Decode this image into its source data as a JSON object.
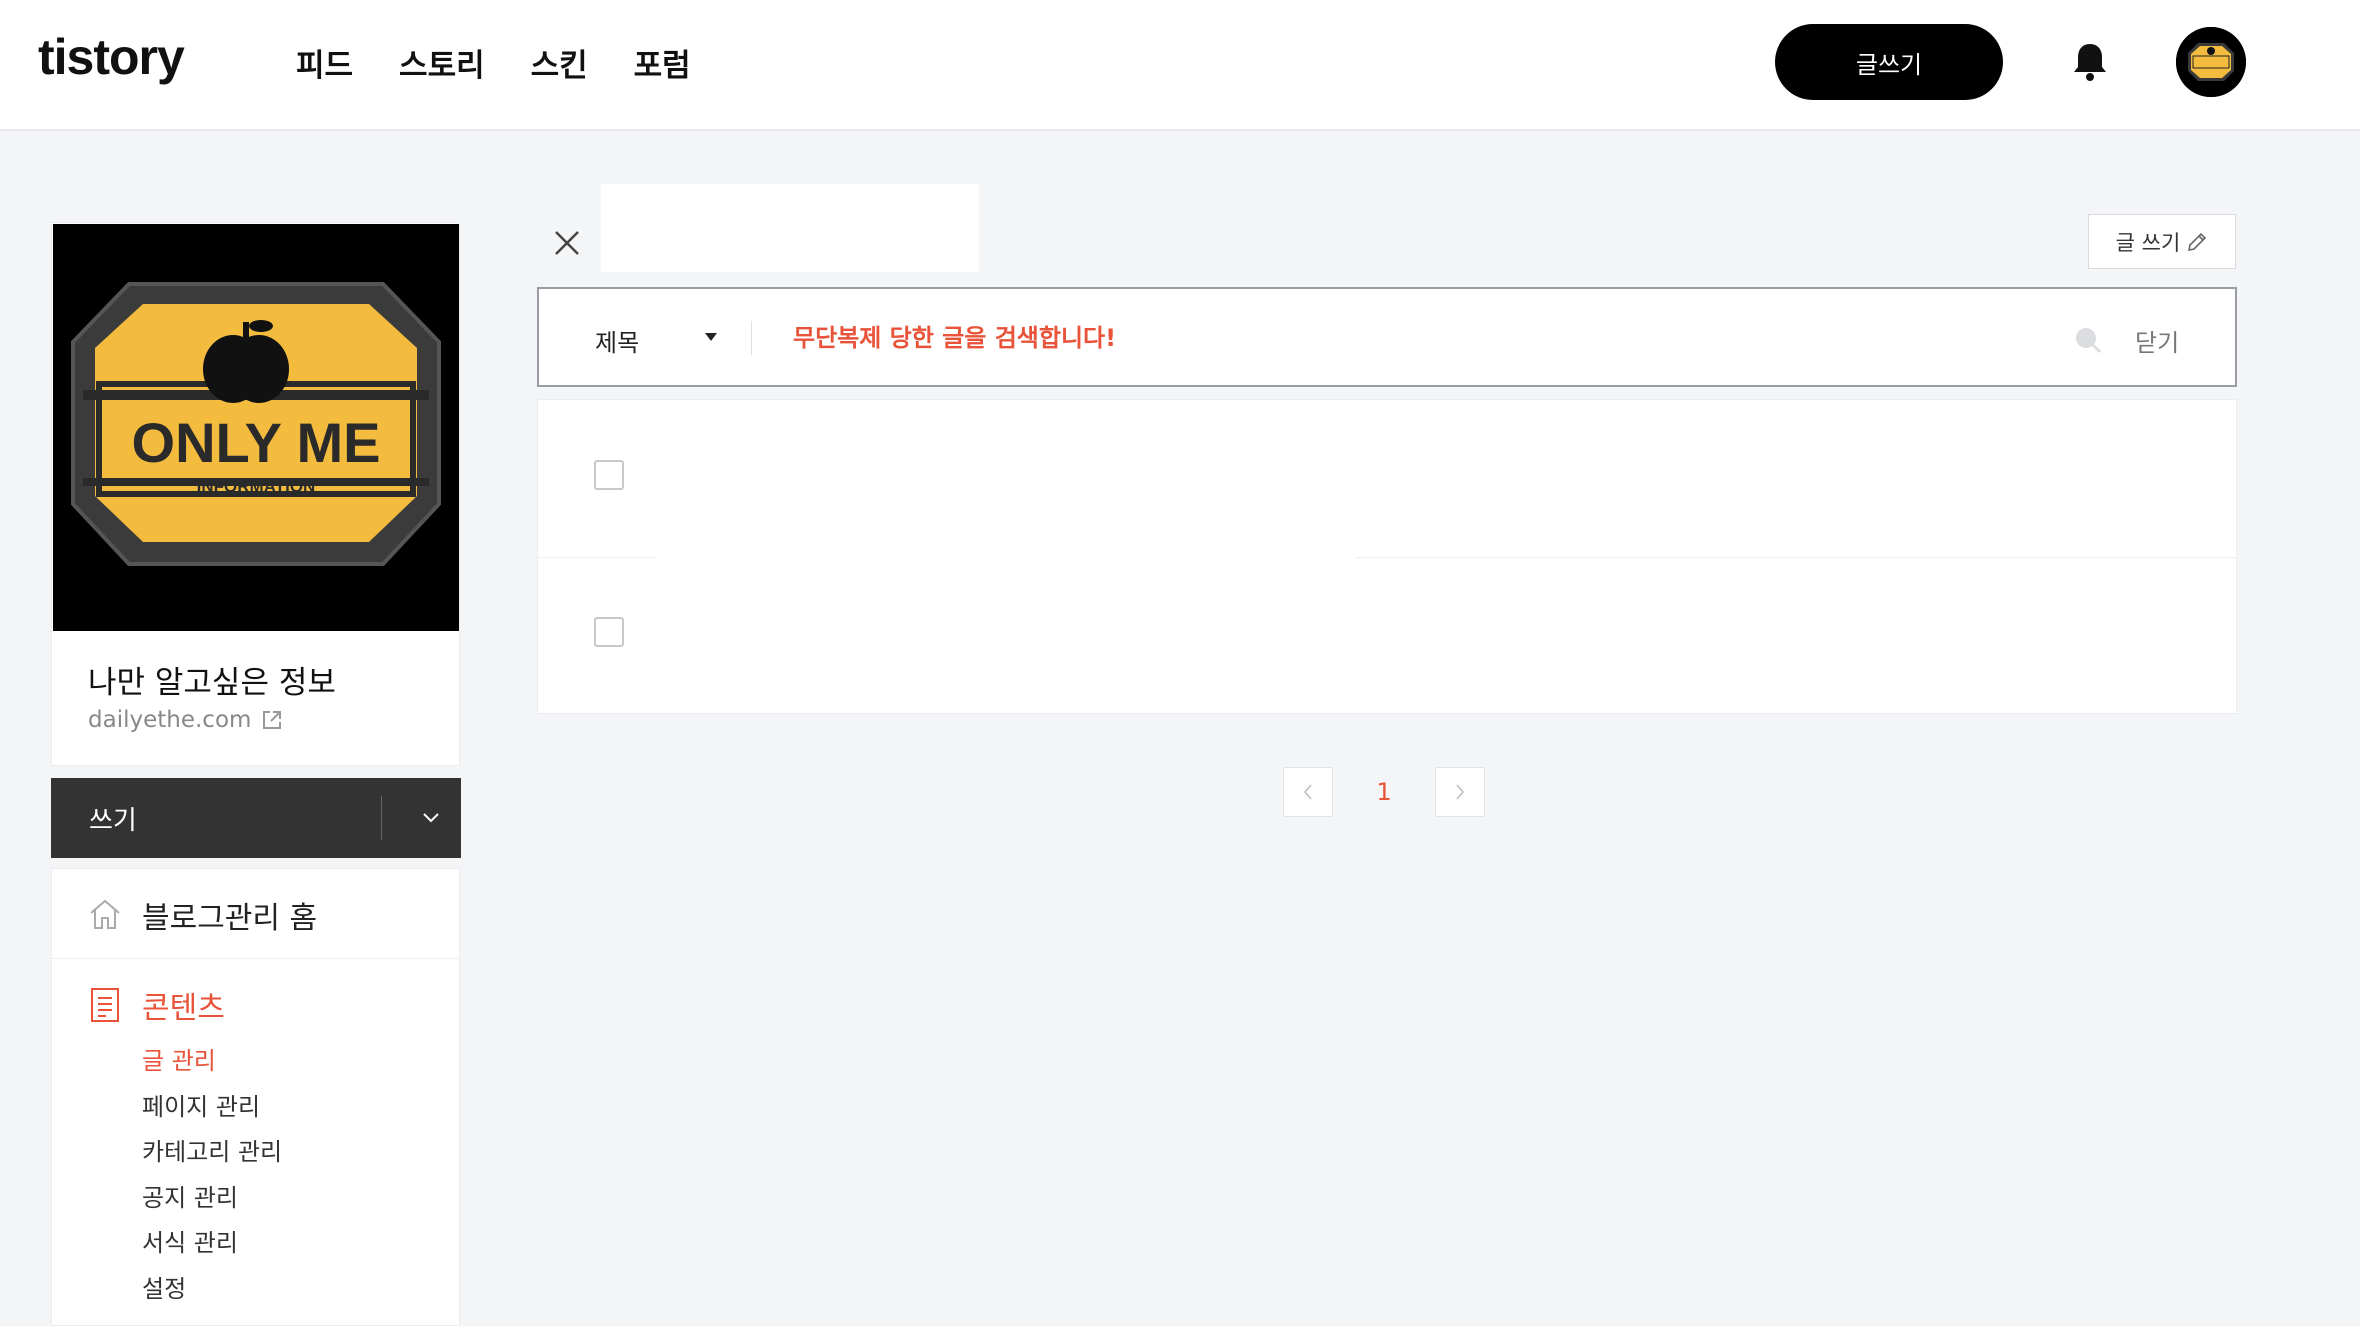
{
  "header": {
    "logo": "tistory",
    "nav": [
      "피드",
      "스토리",
      "스킨",
      "포럼"
    ],
    "write_button": "글쓰기"
  },
  "profile": {
    "logo_text": "ONLY ME",
    "logo_subtext": "INFORMATION",
    "blog_name": "나만 알고싶은 정보",
    "blog_url": "dailyethe.com"
  },
  "sidebar": {
    "write_select": "쓰기",
    "home": "블로그관리 홈",
    "contents": "콘텐츠",
    "submenu": [
      "글 관리",
      "페이지 관리",
      "카테고리 관리",
      "공지 관리",
      "서식 관리",
      "설정"
    ]
  },
  "main": {
    "small_write": "글 쓰기",
    "search": {
      "field": "제목",
      "placeholder": "무단복제 당한 글을 검색합니다!",
      "close": "닫기"
    },
    "pagination": {
      "current": "1"
    }
  },
  "colors": {
    "accent": "#e8533a",
    "dark": "#333333",
    "logo_yellow": "#f3bc3e"
  }
}
